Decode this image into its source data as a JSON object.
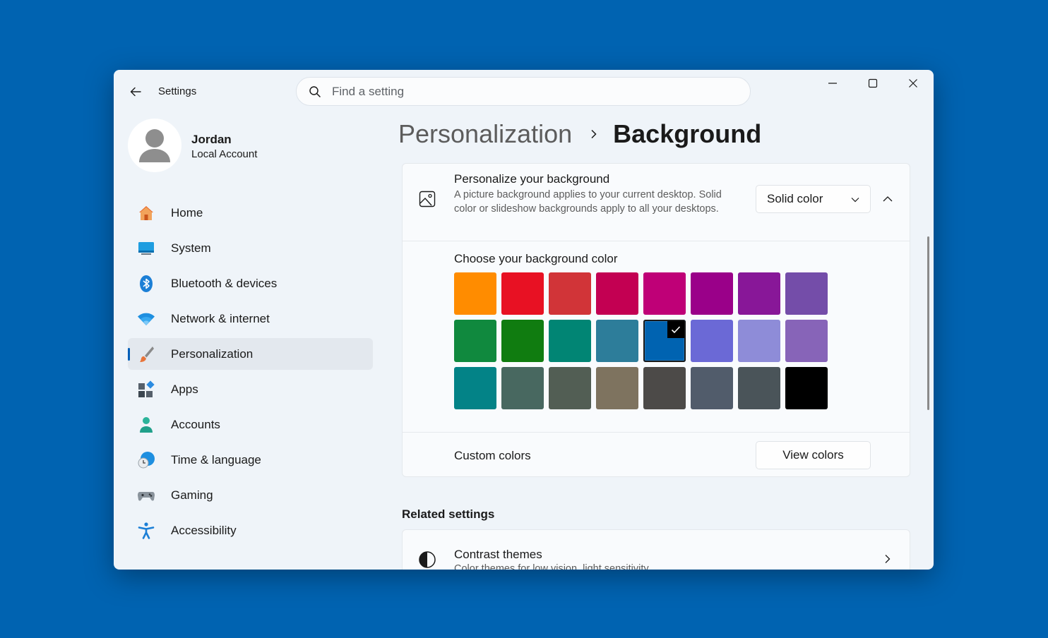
{
  "app": {
    "title": "Settings"
  },
  "search": {
    "placeholder": "Find a setting"
  },
  "user": {
    "name": "Jordan",
    "account_type": "Local Account"
  },
  "nav": {
    "items": [
      {
        "label": "Home",
        "icon": "home-icon"
      },
      {
        "label": "System",
        "icon": "system-icon"
      },
      {
        "label": "Bluetooth & devices",
        "icon": "bluetooth-icon"
      },
      {
        "label": "Network & internet",
        "icon": "wifi-icon"
      },
      {
        "label": "Personalization",
        "icon": "brush-icon",
        "active": true
      },
      {
        "label": "Apps",
        "icon": "apps-icon"
      },
      {
        "label": "Accounts",
        "icon": "accounts-icon"
      },
      {
        "label": "Time & language",
        "icon": "clock-globe-icon"
      },
      {
        "label": "Gaming",
        "icon": "gamepad-icon"
      },
      {
        "label": "Accessibility",
        "icon": "accessibility-icon"
      }
    ]
  },
  "breadcrumb": {
    "parent": "Personalization",
    "current": "Background"
  },
  "background_card": {
    "title": "Personalize your background",
    "description": "A picture background applies to your current desktop. Solid color or slideshow backgrounds apply to all your desktops.",
    "dropdown_value": "Solid color",
    "choose_title": "Choose your background color",
    "colors": [
      [
        "#ff8c00",
        "#e81123",
        "#d13438",
        "#c30052",
        "#bf0077",
        "#9a0089",
        "#881798",
        "#744da9"
      ],
      [
        "#10893e",
        "#107c10",
        "#018574",
        "#2d7d9a",
        "#0063b1",
        "#6b69d6",
        "#8e8cd8",
        "#8764b8"
      ],
      [
        "#038387",
        "#486860",
        "#525e54",
        "#7e735f",
        "#4c4a48",
        "#515c6b",
        "#4a5459",
        "#000000"
      ]
    ],
    "selected_color": "#0063b1",
    "custom_colors_label": "Custom colors",
    "view_colors_label": "View colors"
  },
  "related": {
    "heading": "Related settings",
    "contrast_title": "Contrast themes",
    "contrast_desc": "Color themes for low vision, light sensitivity"
  },
  "colors": {
    "accent": "#005fb8",
    "desktop": "#0063b1",
    "window_bg": "#eff4f9"
  }
}
